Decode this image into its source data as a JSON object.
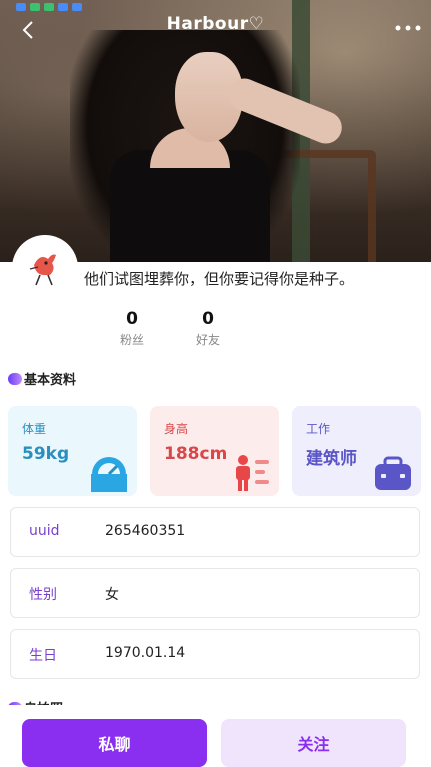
{
  "header": {
    "title": "Harbour♡"
  },
  "profile": {
    "signature": "他们试图埋葬你，但你要记得你是种子。",
    "stats": [
      {
        "value": "0",
        "label": "粉丝"
      },
      {
        "value": "0",
        "label": "好友"
      }
    ]
  },
  "sections": {
    "basic_info": "基本资料",
    "photos": "自拍照"
  },
  "cards": [
    {
      "title": "体重",
      "value": "59kg",
      "icon": "gauge-icon",
      "bg": "#eaf7fc",
      "color": "#2a8fbf"
    },
    {
      "title": "身高",
      "value": "188cm",
      "icon": "height-icon",
      "bg": "#fdecec",
      "color": "#d9474a"
    },
    {
      "title": "工作",
      "value": "建筑师",
      "icon": "briefcase-icon",
      "bg": "#efeefc",
      "color": "#5a56c8"
    }
  ],
  "fields": [
    {
      "label": "uuid",
      "value": "265460351"
    },
    {
      "label": "性别",
      "value": "女"
    },
    {
      "label": "生日",
      "value": "1970.01.14"
    }
  ],
  "actions": {
    "chat": "私聊",
    "follow": "关注"
  },
  "colors": {
    "accent": "#8a2ff0",
    "follow_bg": "#efe4fb",
    "follow_text": "#8a2ff0"
  }
}
